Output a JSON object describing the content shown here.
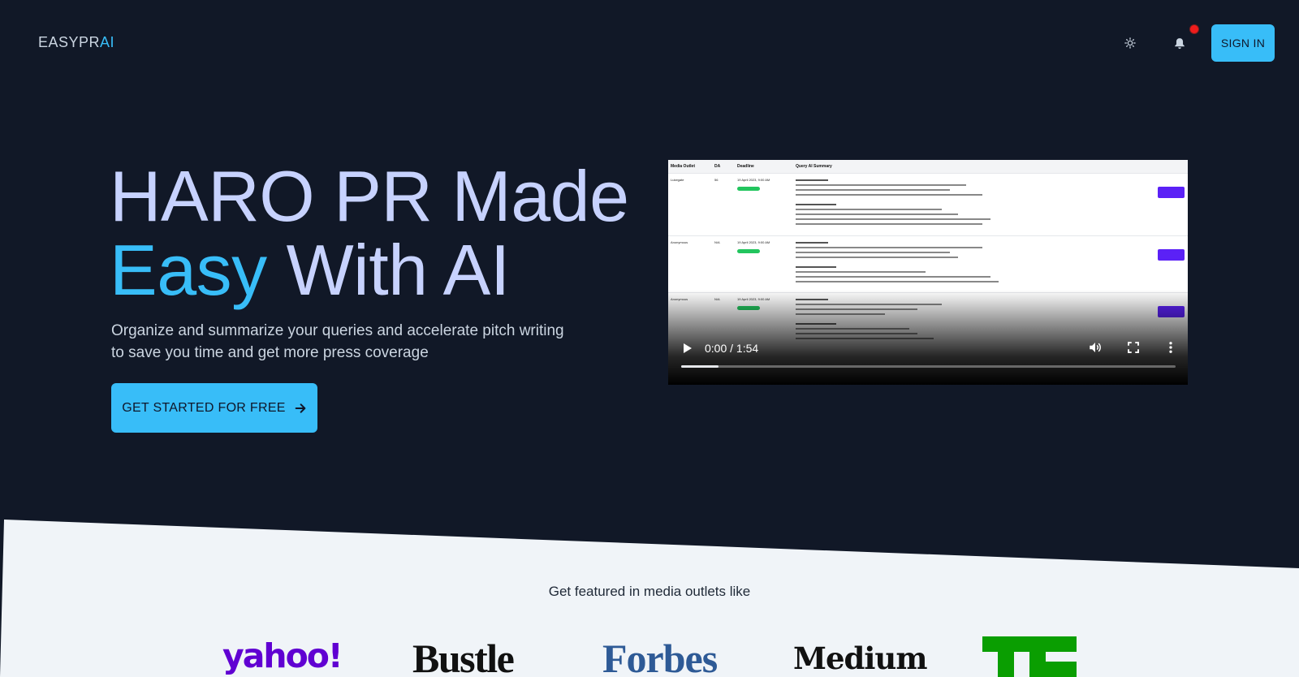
{
  "header": {
    "logo_main": "EASYPR",
    "logo_accent": "AI",
    "signin_label": "SIGN IN"
  },
  "hero": {
    "title_line1": "HARO PR Made",
    "title_accent": "Easy",
    "title_rest": " With AI",
    "subtitle": "Organize and summarize your queries and accelerate pitch writing to save you time and get more press coverage",
    "cta_label": "GET STARTED FOR FREE"
  },
  "video": {
    "time": "0:00 / 1:54",
    "progress": 0.075,
    "table_headers": [
      "Media Outlet",
      "DA",
      "Deadline",
      "Query AI Summary"
    ],
    "rows": [
      {
        "outlet": "Lukegate",
        "da": "56",
        "deadline": "19 April 2023, 9:00 AM"
      },
      {
        "outlet": "Anonymous",
        "da": "N/A",
        "deadline": "19 April 2023, 9:00 AM"
      },
      {
        "outlet": "Anonymous",
        "da": "N/A",
        "deadline": "19 April 2023, 9:00 AM"
      }
    ]
  },
  "featured": {
    "heading": "Get featured in media outlets like",
    "brands": [
      "yahoo!",
      "Bustle",
      "Forbes",
      "Medium",
      "TC"
    ]
  },
  "colors": {
    "background": "#111827",
    "accent": "#38bdf8",
    "title": "#c7d2fe",
    "notification": "#ef1c1c"
  }
}
